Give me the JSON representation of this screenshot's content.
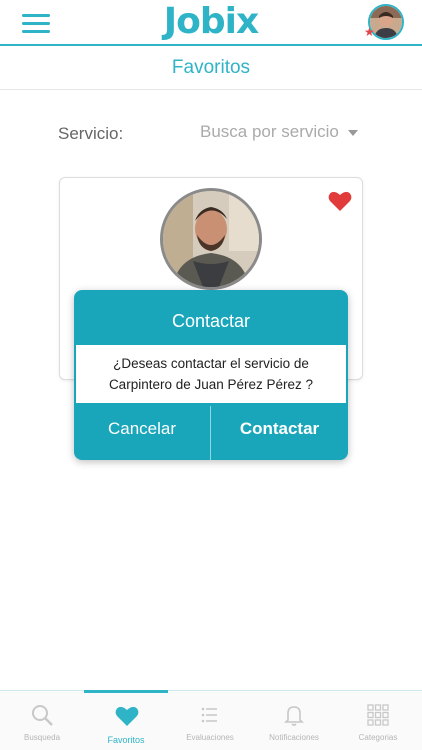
{
  "header": {
    "logo": "Jobix",
    "menu_icon": "hamburger-menu-icon",
    "avatar": "user-avatar"
  },
  "page": {
    "title": "Favoritos"
  },
  "filter": {
    "label": "Servicio:",
    "placeholder": "Busca por servicio"
  },
  "card": {
    "photo": "carpenter-profile-photo",
    "favorite_icon": "heart-icon"
  },
  "dialog": {
    "title": "Contactar",
    "message_line1": "¿Deseas contactar el servicio de",
    "message_line2": "Carpintero de Juan Pérez Pérez ?",
    "cancel_label": "Cancelar",
    "confirm_label": "Contactar"
  },
  "tabbar": {
    "tabs": [
      {
        "label": "Busqueda",
        "icon": "search-icon"
      },
      {
        "label": "Favoritos",
        "icon": "heart-icon",
        "active": true
      },
      {
        "label": "Evaluaciones",
        "icon": "list-icon"
      },
      {
        "label": "Notificaciones",
        "icon": "bell-icon"
      },
      {
        "label": "Categorias",
        "icon": "grid-icon"
      }
    ]
  },
  "colors": {
    "accent": "#2fb4c7",
    "dialog": "#1aa6ba",
    "favorite": "#e23b3b"
  }
}
